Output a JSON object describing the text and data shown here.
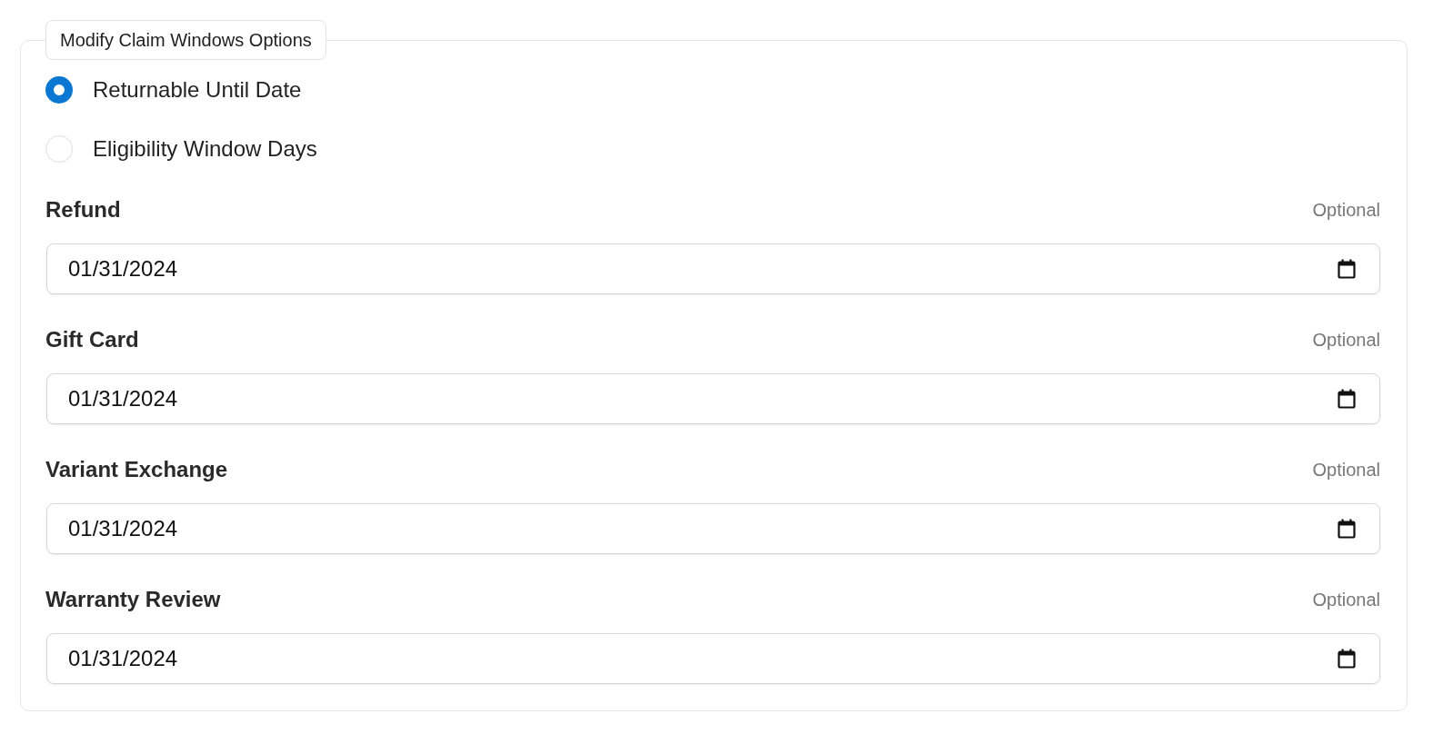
{
  "group": {
    "legend": "Modify Claim Windows Options"
  },
  "options": [
    {
      "label": "Returnable Until Date",
      "selected": true
    },
    {
      "label": "Eligibility Window Days",
      "selected": false
    }
  ],
  "fields": [
    {
      "label": "Refund",
      "hint": "Optional",
      "value": "01/31/2024"
    },
    {
      "label": "Gift Card",
      "hint": "Optional",
      "value": "01/31/2024"
    },
    {
      "label": "Variant Exchange",
      "hint": "Optional",
      "value": "01/31/2024"
    },
    {
      "label": "Warranty Review",
      "hint": "Optional",
      "value": "01/31/2024"
    }
  ]
}
